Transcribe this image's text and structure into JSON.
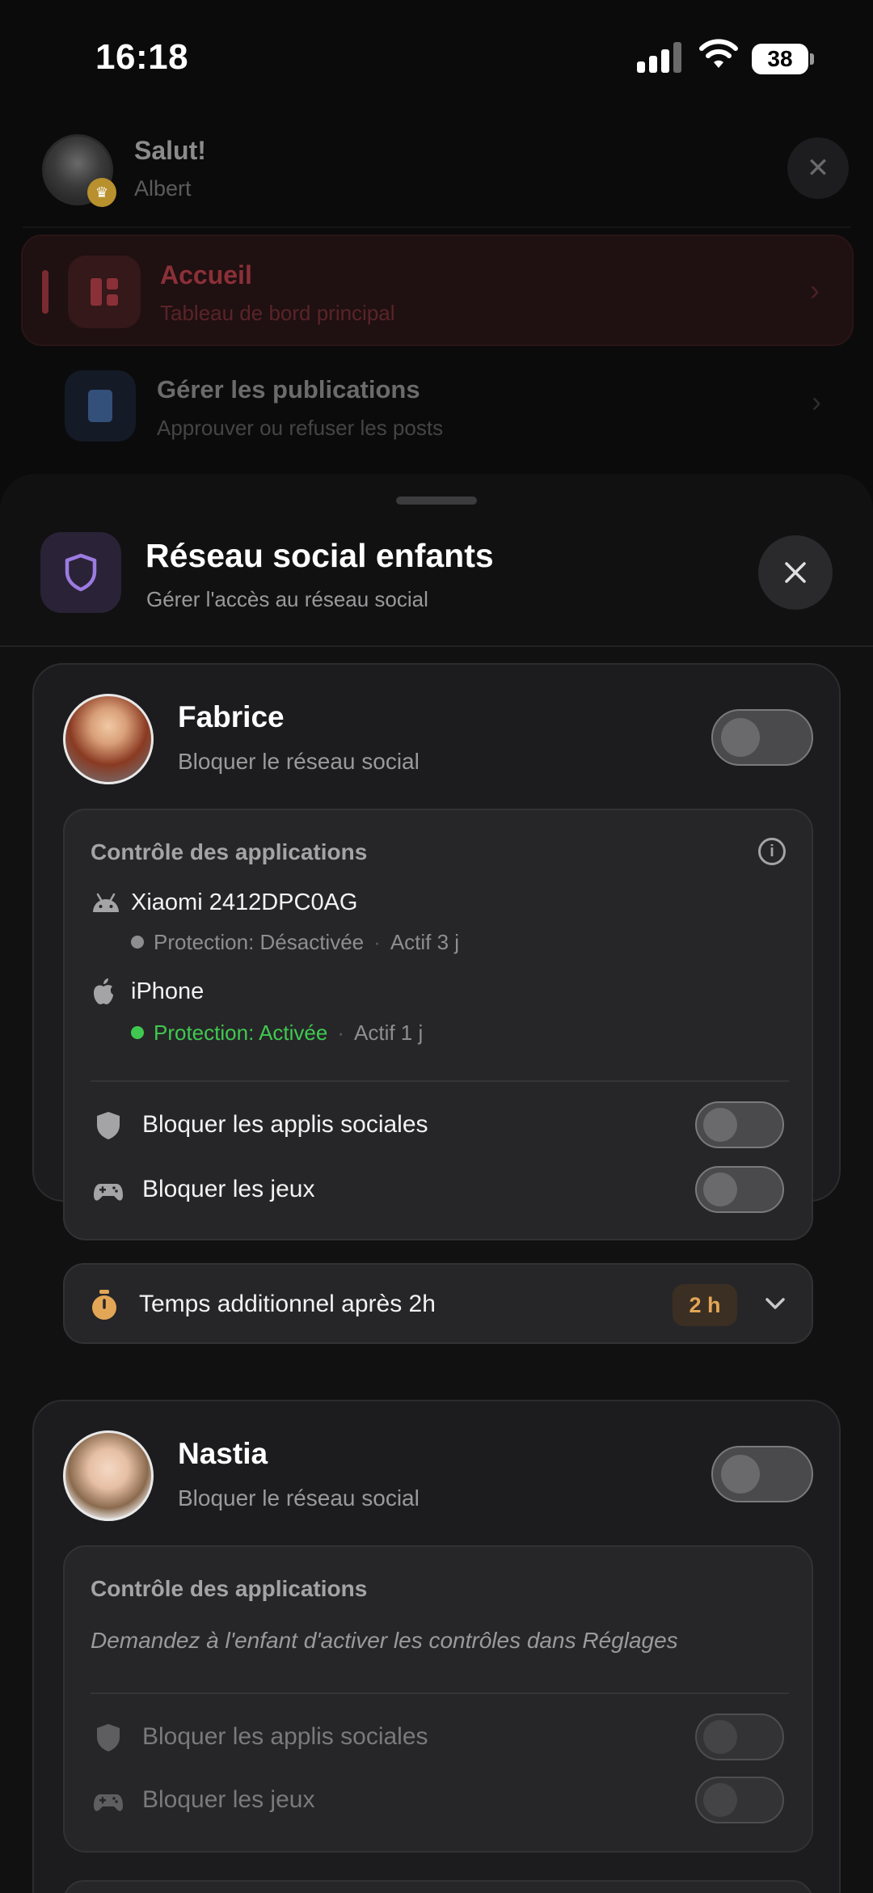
{
  "status_bar": {
    "time": "16:18",
    "battery": "38"
  },
  "background_menu": {
    "greeting": "Salut!",
    "user_name": "Albert",
    "items": [
      {
        "title": "Accueil",
        "subtitle": "Tableau de bord principal",
        "active": true
      },
      {
        "title": "Gérer les publications",
        "subtitle": "Approuver ou refuser les posts",
        "active": false
      }
    ]
  },
  "sheet": {
    "title": "Réseau social enfants",
    "subtitle": "Gérer l'accès au réseau social",
    "accent_color": "#9b7be0",
    "children": [
      {
        "name": "Fabrice",
        "toggle_label": "Bloquer le réseau social",
        "block_social_network": false,
        "apps_control": {
          "title": "Contrôle des applications",
          "devices": [
            {
              "icon": "android-icon",
              "name": "Xiaomi 2412DPC0AG",
              "protection": "Protection: Désactivée",
              "active": "Actif 3 j",
              "status_color": "#8e8e90"
            },
            {
              "icon": "apple-icon",
              "name": "iPhone",
              "protection": "Protection: Activée",
              "active": "Actif 1 j",
              "status_color": "#3fc950"
            }
          ],
          "rows": [
            {
              "icon": "shield-icon",
              "label": "Bloquer les applis sociales",
              "enabled": false
            },
            {
              "icon": "gamepad-icon",
              "label": "Bloquer les jeux",
              "enabled": false
            }
          ]
        },
        "extra_time": {
          "label": "Temps additionnel après 2h",
          "value": "2 h"
        }
      },
      {
        "name": "Nastia",
        "toggle_label": "Bloquer le réseau social",
        "block_social_network": false,
        "apps_control": {
          "title": "Contrôle des applications",
          "hint": "Demandez à l'enfant d'activer les contrôles dans Réglages",
          "rows": [
            {
              "icon": "shield-icon",
              "label": "Bloquer les applis sociales",
              "enabled": false
            },
            {
              "icon": "gamepad-icon",
              "label": "Bloquer les jeux",
              "enabled": false
            }
          ]
        }
      }
    ]
  }
}
